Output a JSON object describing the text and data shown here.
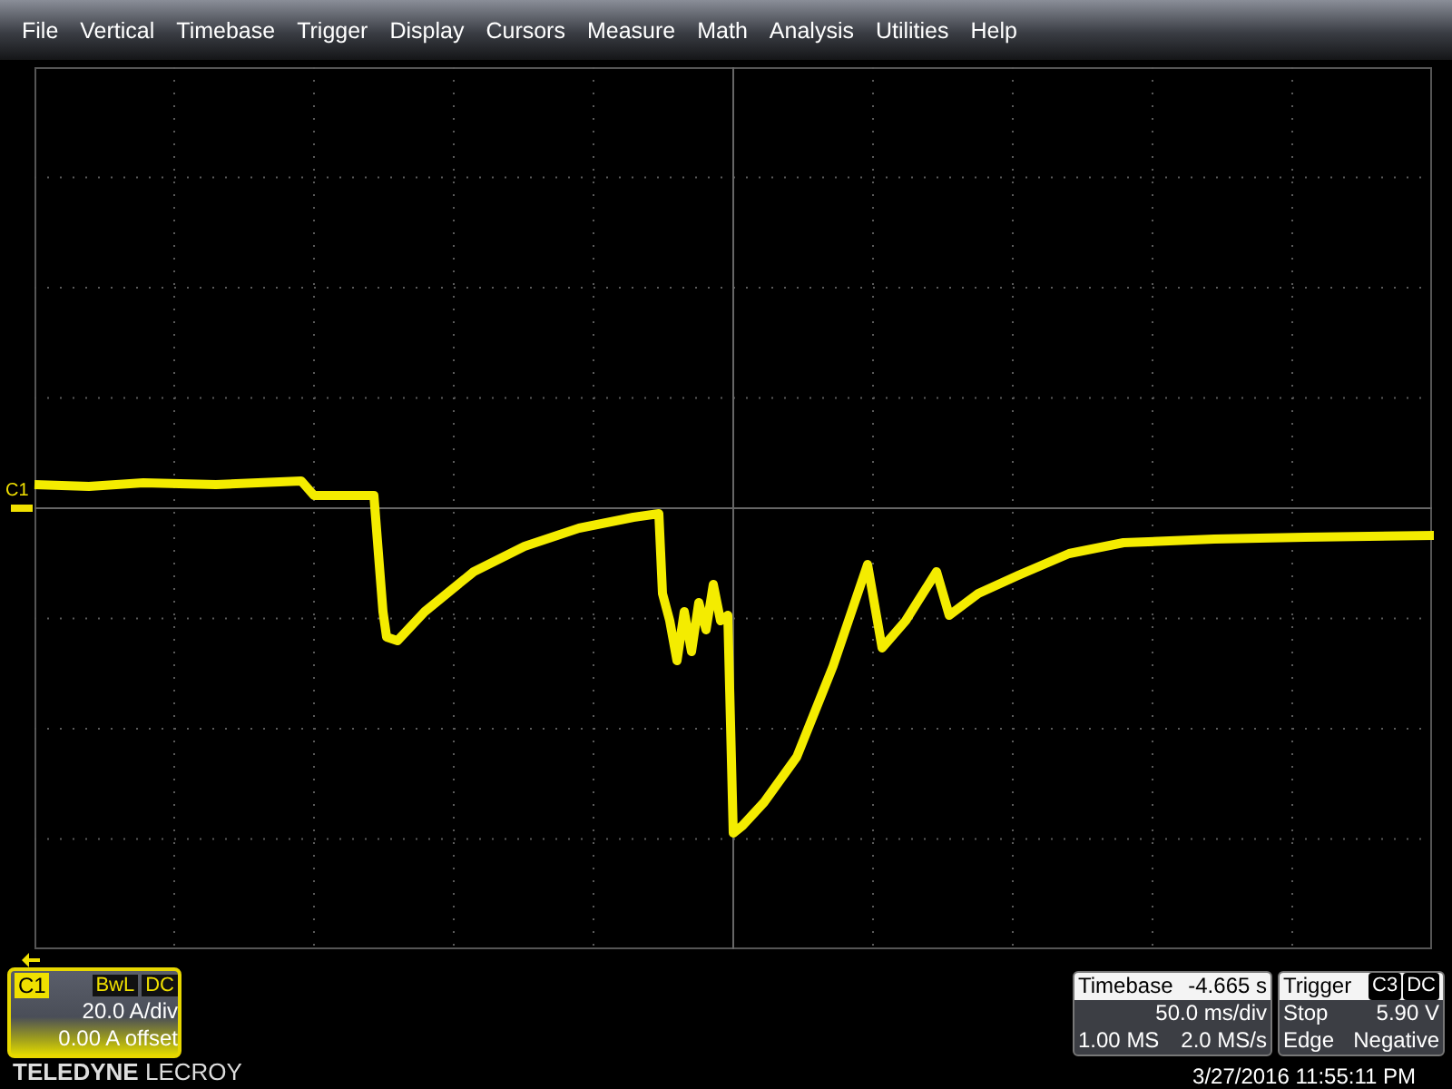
{
  "menu": [
    "File",
    "Vertical",
    "Timebase",
    "Trigger",
    "Display",
    "Cursors",
    "Measure",
    "Math",
    "Analysis",
    "Utilities",
    "Help"
  ],
  "trace": {
    "label": "C1"
  },
  "channel": {
    "label": "C1",
    "bandwidth": "BwL",
    "coupling": "DC",
    "scale": "20.0 A/div",
    "offset": "0.00 A offset"
  },
  "brand": {
    "first": "TELEDYNE",
    "second": "LECROY"
  },
  "timebase": {
    "title": "Timebase",
    "delay": "-4.665 s",
    "scale": "50.0 ms/div",
    "samples": "1.00 MS",
    "rate": "2.0 MS/s"
  },
  "trigger": {
    "title": "Trigger",
    "source": "C3",
    "coupling": "DC",
    "mode": "Stop",
    "level": "5.90 V",
    "type": "Edge",
    "slope": "Negative"
  },
  "timestamp": "3/27/2016 11:55:11 PM"
}
